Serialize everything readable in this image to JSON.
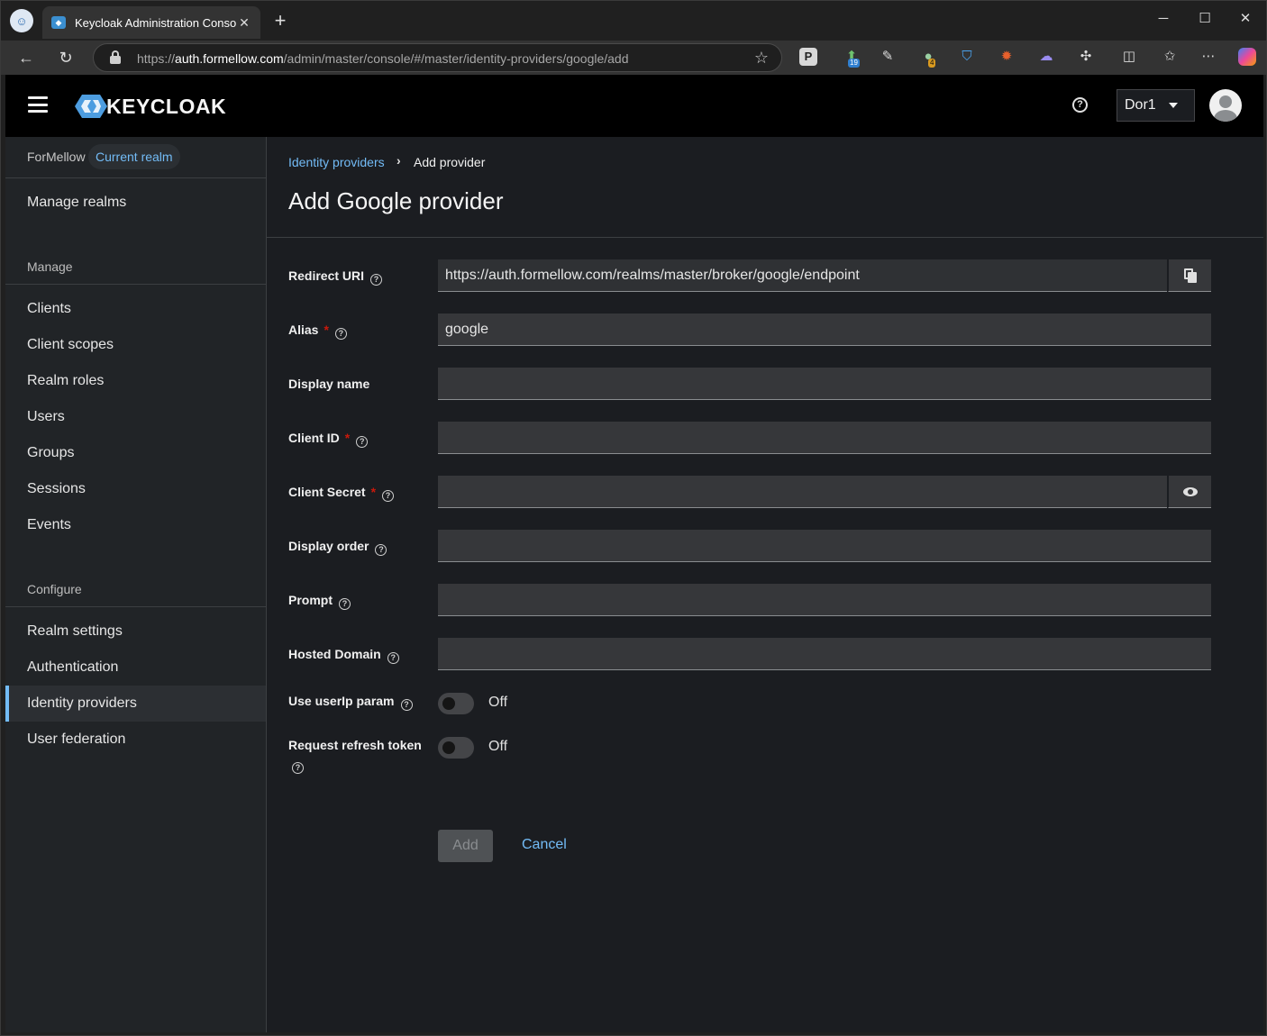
{
  "browser": {
    "tab_title": "Keycloak Administration Console",
    "url_prefix": "https://",
    "url_host": "auth.formellow.com",
    "url_path": "/admin/master/console/#/master/identity-providers/google/add",
    "ext_badge_1": "19",
    "ext_badge_2": "4"
  },
  "header": {
    "logo_text": "KEYCLOAK",
    "user_name": "Dor1"
  },
  "sidebar": {
    "realm_name": "ForMellow",
    "realm_badge": "Current realm",
    "manage_realms": "Manage realms",
    "manage_section": "Manage",
    "manage_items": [
      "Clients",
      "Client scopes",
      "Realm roles",
      "Users",
      "Groups",
      "Sessions",
      "Events"
    ],
    "configure_section": "Configure",
    "configure_items": [
      "Realm settings",
      "Authentication",
      "Identity providers",
      "User federation"
    ],
    "active_item": "Identity providers"
  },
  "breadcrumb": {
    "parent": "Identity providers",
    "current": "Add provider"
  },
  "page": {
    "title": "Add Google provider"
  },
  "form": {
    "redirect_uri": {
      "label": "Redirect URI",
      "value": "https://auth.formellow.com/realms/master/broker/google/endpoint"
    },
    "alias": {
      "label": "Alias",
      "value": "google"
    },
    "display_name": {
      "label": "Display name",
      "value": ""
    },
    "client_id": {
      "label": "Client ID",
      "value": ""
    },
    "client_secret": {
      "label": "Client Secret",
      "value": ""
    },
    "display_order": {
      "label": "Display order",
      "value": ""
    },
    "prompt": {
      "label": "Prompt",
      "value": ""
    },
    "hosted_domain": {
      "label": "Hosted Domain",
      "value": ""
    },
    "use_userip": {
      "label": "Use userIp param",
      "state": "Off"
    },
    "request_refresh": {
      "label": "Request refresh token",
      "state": "Off"
    },
    "required_mark": "*",
    "add_label": "Add",
    "cancel_label": "Cancel"
  },
  "colors": {
    "link": "#73bcf7",
    "required": "#c9190b",
    "active_border": "#73bcf7"
  }
}
